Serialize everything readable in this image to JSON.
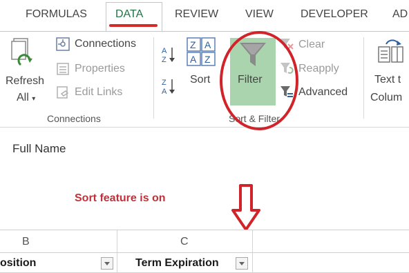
{
  "tabs": [
    {
      "label": "FORMULAS",
      "active": false
    },
    {
      "label": "DATA",
      "active": true
    },
    {
      "label": "REVIEW",
      "active": false
    },
    {
      "label": "VIEW",
      "active": false
    },
    {
      "label": "DEVELOPER",
      "active": false
    },
    {
      "label": "AD",
      "active": false
    }
  ],
  "ribbon": {
    "connections_group": {
      "refresh_label_1": "Refresh",
      "refresh_label_2": "All",
      "connections_label": "Connections",
      "properties_label": "Properties",
      "edit_links_label": "Edit Links",
      "group_label": "Connections"
    },
    "sort_filter_group": {
      "sort_label": "Sort",
      "filter_label": "Filter",
      "clear_label": "Clear",
      "reapply_label": "Reapply",
      "advanced_label": "Advanced",
      "group_label": "Sort & Filter"
    },
    "data_tools": {
      "text_to_columns_1": "Text t",
      "text_to_columns_2": "Colum"
    }
  },
  "sheet": {
    "cell_text": "Full Name",
    "note": "Sort feature is on",
    "columns": [
      "B",
      "C"
    ],
    "header_row": [
      "osition",
      "Term Expiration"
    ]
  },
  "colors": {
    "accent_green": "#217346",
    "highlight_red": "#d1232a",
    "filter_highlight": "#a9d4ae"
  }
}
